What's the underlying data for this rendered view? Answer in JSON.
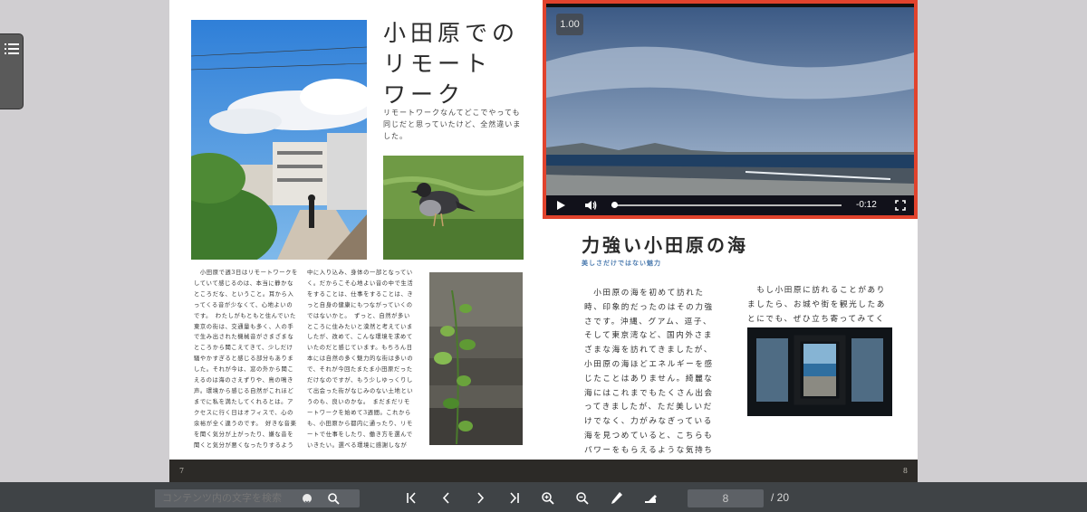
{
  "left_page": {
    "title_lines": [
      "小田原での",
      "リモート",
      "ワーク"
    ],
    "lead": "リモートワークなんてどこでやっても同じだと思っていたけど、全然違いました。",
    "col1": "　小田原で週3日はリモートワークをしていて感じるのは、本当に静かなところだな、ということ。耳から入ってくる音が少なくて、心地よいのです。　わたしがもともと住んでいた東京の街は、交通量も多く、人の手で生み出された機械音がさまざまなところから聞こえてきて、少しだけ騒やかすぎると感じる部分もありました。それが今は、窓の外から聞こえるのは海のさえずりや、鳥の鳴き声。環境から感じる自然がこれほどまでに私を満たしてくれるとは。アクセスに行く日はオフィスで、心の余裕が全く違うのです。　好きな音楽を聞く気分が上がったり、嫌な音を聞くと気分が悪くなったりするように、耳から入ってくる良くない何かは、心にダイレクトに響きます。生活の中で聞こえる音は、知らず知らずのうちに自分の",
    "col2": "中に入り込み、身体の一部となっていく。だからこそ心地よい音の中で生活をすることは、仕事をすることは、きっと自身の健康にもつながっていくのではないかと。　ずっと、自然が多いところに住みたいと漠然と考えていましたが、改めて、こんな環境を求めていたのだと感じています。もちろん日本には自然の多く魅力的な街は多いので、それが今回たまたま小田原だっただけなのですが、もう少しゆっくりして出会った街がなじみのない土地というのも、良いのかな。　まだまだリモートワークを始めて3週間。これからも、小田原から都内に通ったり、リモートで仕事をしたり、働き方を選んでいきたい。選べる環境に感謝しながら、仕事とプライベートを分けるのが苦手なタイプでもあるので、どちらも楽しみつつ、より良くしていきます。",
    "page_number": "7"
  },
  "right_page": {
    "heading": "力強い小田原の海",
    "subheading": "美しさだけではない魅力",
    "col1": "　小田原の海を初めて訪れた時、印象的だったのはその力強さです。沖縄、グアム、逗子、そして東京湾など、国内外さまざまな海を訪れてきましたが、小田原の海ほどエネルギーを感じたことはありません。綺麗な海にはこれまでもたくさん出会ってきましたが、ただ美しいだけでなく、力がみなぎっている海を見つめていると、こちらもパワーをもらえるような気持ちになります。何十何百年前から、人々に元気を与え続けてきたのが、小田原の海なんだと思うのです。",
    "col2": "　もし小田原に訪れることがありましたら、お城や街を観光したあとにでも、ぜひ立ち寄ってみてください。",
    "page_number": "8"
  },
  "video": {
    "playback_rate": "1.00",
    "time_remaining": "-0:12",
    "progress": 0.01
  },
  "toolbar": {
    "search_placeholder": "コンテンツ内の文字を検索",
    "current_page": "8",
    "total_pages": "/ 20"
  },
  "icons": {
    "menu": "list-icon",
    "first": "first-page-icon",
    "prev": "prev-page-icon",
    "next": "next-page-icon",
    "last": "last-page-icon",
    "zoom_in": "zoom-in-icon",
    "zoom_out": "zoom-out-icon",
    "pen": "pen-icon",
    "highlight": "marker-icon"
  },
  "colors": {
    "video_border": "#e1432d",
    "accent_sub": "#4d7cb0",
    "toolbar_bg": "#3f4346"
  }
}
